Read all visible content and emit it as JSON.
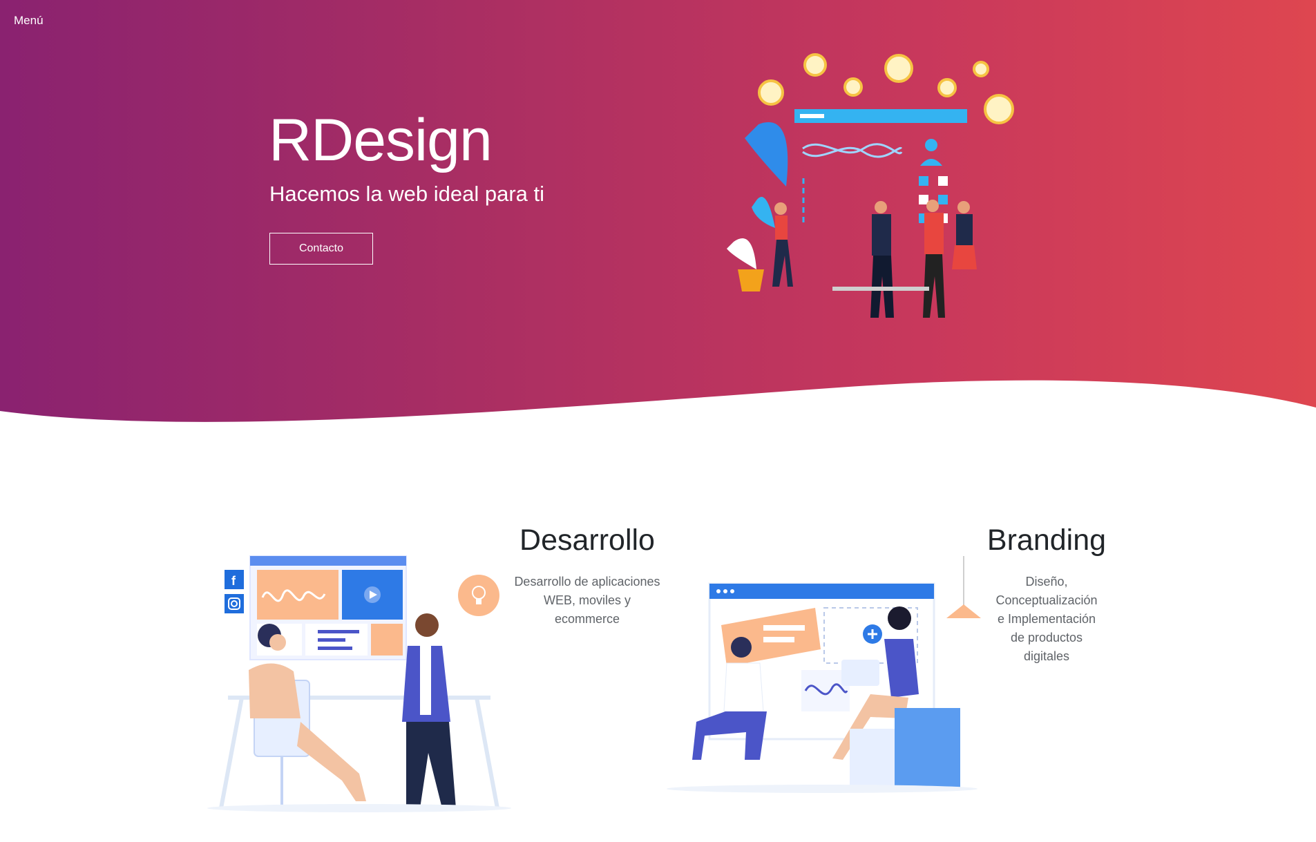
{
  "nav": {
    "menu_label": "Menú"
  },
  "hero": {
    "title": "RDesign",
    "tagline": "Hacemos la web ideal para ti",
    "cta_label": "Contacto"
  },
  "services": [
    {
      "title": "Desarrollo",
      "description": "Desarrollo de aplicaciones WEB, moviles y ecommerce"
    },
    {
      "title": "Branding",
      "description": "Diseño, Conceptualización e Implementación de productos digitales"
    }
  ],
  "colors": {
    "gradient_start": "#8a2270",
    "gradient_end": "#de4650",
    "accent_blue": "#2e7ae6",
    "accent_peach": "#fbb98c"
  },
  "icons": [
    "facebook-icon",
    "instagram-icon",
    "lightbulb-icon",
    "play-icon",
    "plus-icon",
    "checkbox-icon",
    "clock-icon"
  ]
}
